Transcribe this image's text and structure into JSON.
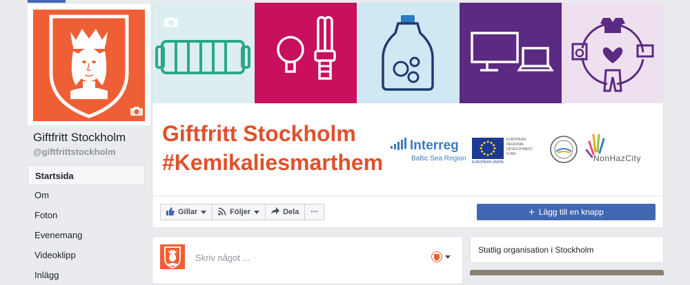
{
  "page": {
    "name": "Giftfritt Stockholm",
    "handle": "@giftfrittstockholm"
  },
  "nav": {
    "items": [
      {
        "label": "Startsida",
        "active": true
      },
      {
        "label": "Om"
      },
      {
        "label": "Foton"
      },
      {
        "label": "Evenemang"
      },
      {
        "label": "Videoklipp"
      },
      {
        "label": "Inlägg"
      }
    ]
  },
  "cover": {
    "title_line1": "Giftfritt Stockholm",
    "title_line2": "#Kemikaliesmarthem",
    "tile_colors": [
      "#dceef0",
      "#c8105c",
      "#cfe8f4",
      "#5b2a82",
      "#efe0ef"
    ],
    "tile_icons": [
      "radiator-icon",
      "lightbulb-icon",
      "detergent-bottle-icon",
      "computer-screens-icon",
      "recycle-cycle-icon"
    ],
    "interreg_name": "Interreg",
    "interreg_sub": "Baltic Sea Region",
    "eu_label": "EUROPEAN UNION",
    "erdf_label": "EUROPEAN REGIONAL DEVELOPMENT FUND",
    "nonhazcity_label": "NonHazCity"
  },
  "actions": {
    "like_label": "Gillar",
    "follow_label": "Följer",
    "share_label": "Dela",
    "more_label": "···",
    "add_button_label": "Lägg till en knapp"
  },
  "composer": {
    "placeholder": "Skriv något ..."
  },
  "about": {
    "category": "Statlig organisation i Stockholm"
  },
  "colors": {
    "brand_orange": "#ee5f35",
    "title_orange": "#e1502b",
    "fb_blue": "#4267b2"
  }
}
